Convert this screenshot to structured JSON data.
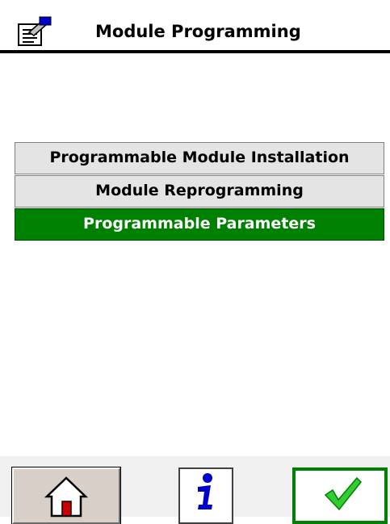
{
  "title": "Module Programming",
  "menu": {
    "items": [
      {
        "label": "Programmable Module Installation",
        "selected": false
      },
      {
        "label": "Module Reprogramming",
        "selected": false
      },
      {
        "label": "Programmable Parameters",
        "selected": true
      }
    ]
  },
  "toolbar": {
    "home_icon": "home-icon",
    "info_icon": "info-icon",
    "ok_icon": "checkmark-icon"
  },
  "colors": {
    "selected_bg": "#008000",
    "item_bg": "#e4e4e4",
    "ok_border": "#008000",
    "info_icon": "#0000cc"
  }
}
